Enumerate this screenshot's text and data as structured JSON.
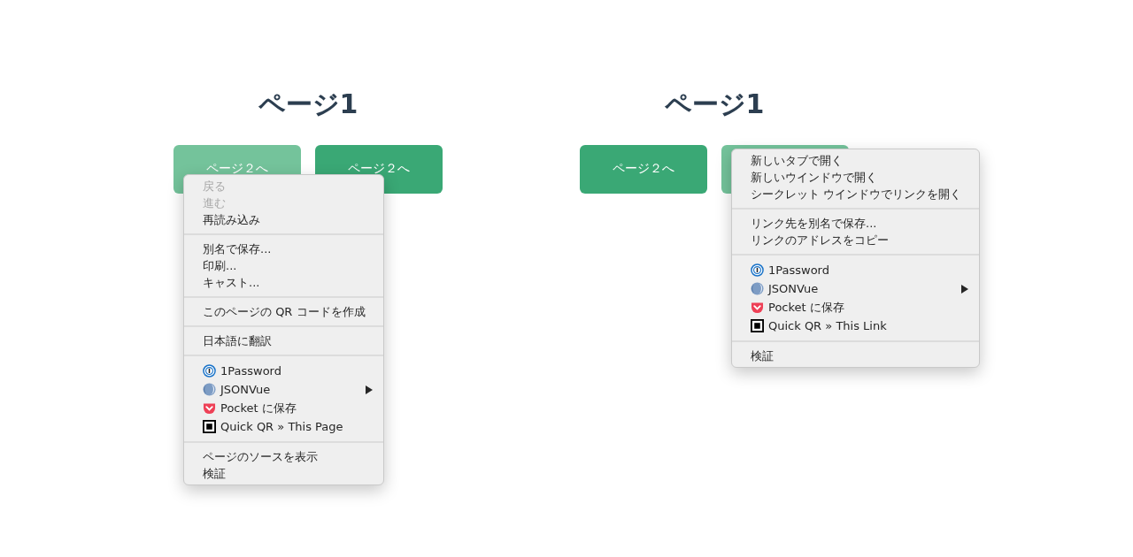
{
  "panels": [
    {
      "heading": "ページ1",
      "buttons": [
        {
          "label": "ページ２へ",
          "selected": true
        },
        {
          "label": "ページ２へ",
          "selected": false
        }
      ],
      "menu": {
        "groups": [
          [
            {
              "kind": "command",
              "label": "戻る",
              "disabled": true,
              "submenu": false
            },
            {
              "kind": "command",
              "label": "進む",
              "disabled": true,
              "submenu": false
            },
            {
              "kind": "command",
              "label": "再読み込み",
              "disabled": false,
              "submenu": false
            }
          ],
          [
            {
              "kind": "command",
              "label": "別名で保存...",
              "disabled": false,
              "submenu": false
            },
            {
              "kind": "command",
              "label": "印刷...",
              "disabled": false,
              "submenu": false
            },
            {
              "kind": "command",
              "label": "キャスト...",
              "disabled": false,
              "submenu": false
            }
          ],
          [
            {
              "kind": "command",
              "label": "このページの QR コードを作成",
              "disabled": false,
              "submenu": false
            }
          ],
          [
            {
              "kind": "command",
              "label": "日本語に翻訳",
              "disabled": false,
              "submenu": false
            }
          ],
          [
            {
              "kind": "extension",
              "label": "1Password",
              "disabled": false,
              "submenu": false
            },
            {
              "kind": "extension",
              "label": "JSONVue",
              "disabled": false,
              "submenu": true
            },
            {
              "kind": "extension",
              "label": "Pocket に保存",
              "disabled": false,
              "submenu": false
            },
            {
              "kind": "extension",
              "label": "Quick QR » This Page",
              "disabled": false,
              "submenu": false
            }
          ],
          [
            {
              "kind": "command",
              "label": "ページのソースを表示",
              "disabled": false,
              "submenu": false
            },
            {
              "kind": "command",
              "label": "検証",
              "disabled": false,
              "submenu": false
            }
          ]
        ]
      }
    },
    {
      "heading": "ページ1",
      "buttons": [
        {
          "label": "ページ２へ",
          "selected": false
        },
        {
          "selected": true
        }
      ],
      "menu": {
        "groups": [
          [
            {
              "kind": "command",
              "label": "新しいタブで開く",
              "disabled": false,
              "submenu": false
            },
            {
              "kind": "command",
              "label": "新しいウインドウで開く",
              "disabled": false,
              "submenu": false
            },
            {
              "kind": "command",
              "label": "シークレット ウインドウでリンクを開く",
              "disabled": false,
              "submenu": false
            }
          ],
          [
            {
              "kind": "command",
              "label": "リンク先を別名で保存...",
              "disabled": false,
              "submenu": false
            },
            {
              "kind": "command",
              "label": "リンクのアドレスをコピー",
              "disabled": false,
              "submenu": false
            }
          ],
          [
            {
              "kind": "extension",
              "label": "1Password",
              "disabled": false,
              "submenu": false
            },
            {
              "kind": "extension",
              "label": "JSONVue",
              "disabled": false,
              "submenu": true
            },
            {
              "kind": "extension",
              "label": "Pocket に保存",
              "disabled": false,
              "submenu": false
            },
            {
              "kind": "extension",
              "label": "Quick QR » This Link",
              "disabled": false,
              "submenu": false
            }
          ],
          [
            {
              "kind": "command",
              "label": "検証",
              "disabled": false,
              "submenu": false
            }
          ]
        ]
      }
    }
  ]
}
